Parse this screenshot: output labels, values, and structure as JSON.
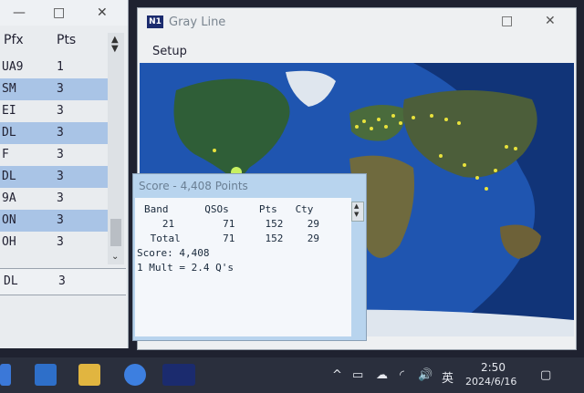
{
  "left_window": {
    "minimize": "—",
    "maximize": "□",
    "close": "✕",
    "col_pfx": "Pfx",
    "col_pts": "Pts",
    "rows": [
      {
        "pfx": "UA9",
        "pts": "1",
        "hl": false
      },
      {
        "pfx": "SM",
        "pts": "3",
        "hl": true
      },
      {
        "pfx": "EI",
        "pts": "3",
        "hl": false
      },
      {
        "pfx": "DL",
        "pts": "3",
        "hl": true
      },
      {
        "pfx": "F",
        "pts": "3",
        "hl": false
      },
      {
        "pfx": "DL",
        "pts": "3",
        "hl": true
      },
      {
        "pfx": "9A",
        "pts": "3",
        "hl": false
      },
      {
        "pfx": "ON",
        "pts": "3",
        "hl": true
      },
      {
        "pfx": "OH",
        "pts": "3",
        "hl": false
      }
    ],
    "bottom": {
      "pfx": "DL",
      "pts": "3"
    }
  },
  "gray_line": {
    "logo": "N1",
    "title": "Gray Line",
    "menu_setup": "Setup",
    "maximize": "□",
    "close": "✕"
  },
  "score": {
    "title": "Score - 4,408 Points",
    "header": "Band      QSOs     Pts   Cty",
    "row1": "   21        71     152    29",
    "row2": " Total       71     152    29",
    "score_line": "Score: 4,408",
    "mult_line": "1 Mult = 2.4 Q's"
  },
  "taskbar": {
    "tray_ime": "英",
    "tray_volume": "🔊",
    "time": "2:50",
    "date": "2024/6/16"
  }
}
